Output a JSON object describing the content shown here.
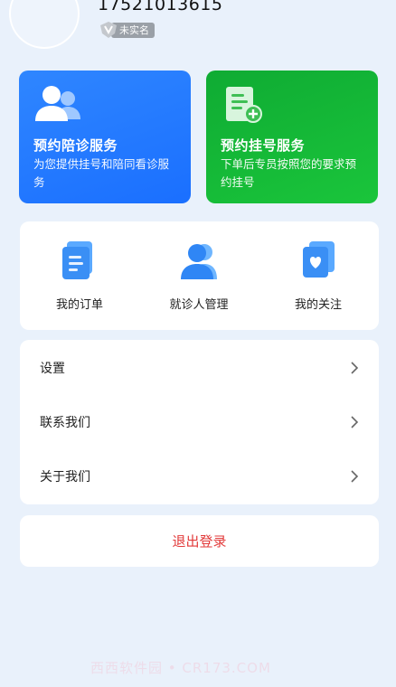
{
  "profile": {
    "phone": "17521013615",
    "verify_badge": "未实名",
    "verify_icon": "v-shield-icon"
  },
  "services": [
    {
      "title": "预约陪诊服务",
      "desc": "为您提供挂号和陪同看诊服务",
      "icon": "people-icon",
      "color": "#1a6fff"
    },
    {
      "title": "预约挂号服务",
      "desc": "下单后专员按照您的要求预约挂号",
      "icon": "document-add-icon",
      "color": "#12b837"
    }
  ],
  "quick_links": [
    {
      "label": "我的订单",
      "icon": "document-icon"
    },
    {
      "label": "就诊人管理",
      "icon": "patient-icon"
    },
    {
      "label": "我的关注",
      "icon": "heart-card-icon"
    }
  ],
  "menu": [
    {
      "label": "设置"
    },
    {
      "label": "联系我们"
    },
    {
      "label": "关于我们"
    }
  ],
  "logout": {
    "label": "退出登录",
    "color": "#e23a3a"
  },
  "watermark": "西西软件园 • CR173.COM"
}
